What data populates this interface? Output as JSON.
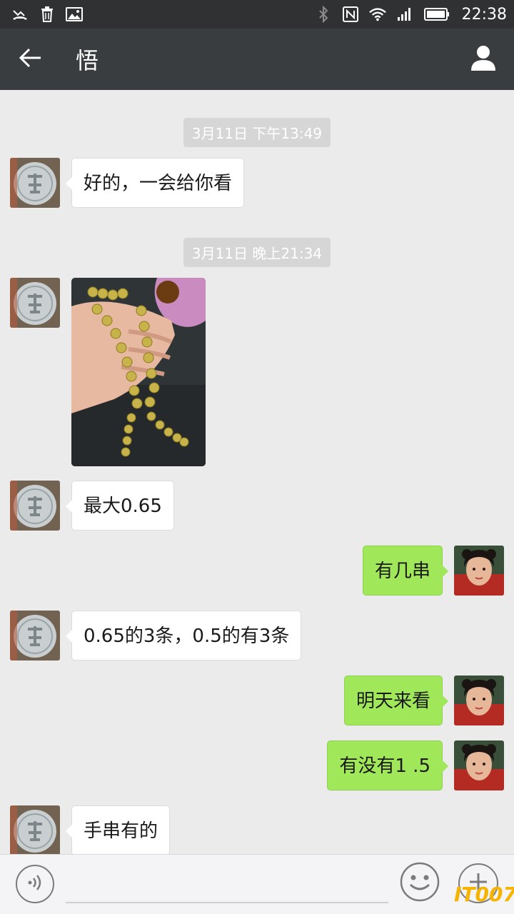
{
  "status_bar": {
    "time": "22:38",
    "left_icons": [
      "missed-call-icon",
      "trash-icon",
      "image-icon"
    ],
    "right_icons": [
      "bluetooth-icon",
      "nfc-icon",
      "wifi-icon",
      "signal-icon",
      "battery-icon"
    ]
  },
  "header": {
    "title": "悟",
    "back_icon": "arrow-left-icon",
    "profile_icon": "person-icon"
  },
  "messages": [
    {
      "type": "timestamp",
      "text": "3月11日 下午13:49"
    },
    {
      "type": "text",
      "side": "in",
      "text": "好的，一会给你看"
    },
    {
      "type": "timestamp",
      "text": "3月11日 晚上21:34"
    },
    {
      "type": "image",
      "side": "in",
      "alt": "bracelet-photo"
    },
    {
      "type": "text",
      "side": "in",
      "text": "最大0.65"
    },
    {
      "type": "text",
      "side": "out",
      "text": "有几串"
    },
    {
      "type": "text",
      "side": "in",
      "text": "0.65的3条，0.5的有3条"
    },
    {
      "type": "text",
      "side": "out",
      "text": "明天来看"
    },
    {
      "type": "text",
      "side": "out",
      "text": "有没有1 .5"
    },
    {
      "type": "text",
      "side": "in",
      "text": "手串有的"
    }
  ],
  "input_bar": {
    "value": "",
    "voice_icon": "voice-icon",
    "emoji_icon": "emoji-icon",
    "more_icon": "plus-icon"
  },
  "watermark": "IT007",
  "colors": {
    "status_bar": "#2f3133",
    "header": "#3a3d40",
    "chat_bg": "#ebebeb",
    "outgoing_bubble": "#a0e75a",
    "incoming_bubble": "#ffffff"
  }
}
